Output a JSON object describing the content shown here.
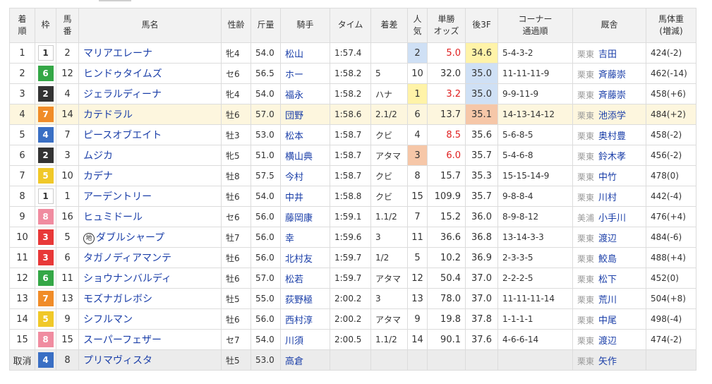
{
  "headers": {
    "rank": "着\n順",
    "waku": "枠",
    "umaban": "馬\n番",
    "name": "馬名",
    "sexage": "性齢",
    "kinryo": "斤量",
    "jockey": "騎手",
    "time": "タイム",
    "margin": "着差",
    "pop": "人\n気",
    "odds": "単勝\nオッズ",
    "last3f": "後3F",
    "corner": "コーナー\n通過順",
    "trainer": "厩舎",
    "weight": "馬体重\n(増減)"
  },
  "rows": [
    {
      "rank": "1",
      "waku": "1",
      "umaban": "2",
      "name": "マリアエレーナ",
      "sexage": "牝4",
      "kinryo": "54.0",
      "jockey": "松山",
      "time": "1:57.4",
      "margin": "",
      "pop": "2",
      "odds": "5.0",
      "oddsRed": true,
      "last3f": "34.6",
      "l3rank": 1,
      "corner": "5-4-3-2",
      "area": "栗東",
      "trainer": "吉田",
      "weight": "424(-2)"
    },
    {
      "rank": "2",
      "waku": "6",
      "umaban": "12",
      "name": "ヒンドゥタイムズ",
      "sexage": "セ6",
      "kinryo": "56.5",
      "jockey": "ホー",
      "time": "1:58.2",
      "margin": "5",
      "pop": "10",
      "odds": "32.0",
      "oddsRed": false,
      "last3f": "35.0",
      "l3rank": 2,
      "corner": "11-11-11-9",
      "area": "栗東",
      "trainer": "斉藤崇",
      "weight": "462(-14)"
    },
    {
      "rank": "3",
      "waku": "2",
      "umaban": "4",
      "name": "ジェラルディーナ",
      "sexage": "牝4",
      "kinryo": "54.0",
      "jockey": "福永",
      "time": "1:58.2",
      "margin": "ハナ",
      "pop": "1",
      "odds": "3.2",
      "oddsRed": true,
      "last3f": "35.0",
      "l3rank": 2,
      "corner": "9-9-11-9",
      "area": "栗東",
      "trainer": "斉藤崇",
      "weight": "458(+6)"
    },
    {
      "rank": "4",
      "waku": "7",
      "umaban": "14",
      "name": "カテドラル",
      "sexage": "牡6",
      "kinryo": "57.0",
      "jockey": "団野",
      "time": "1:58.6",
      "margin": "2.1/2",
      "pop": "6",
      "odds": "13.7",
      "oddsRed": false,
      "last3f": "35.1",
      "l3rank": 3,
      "corner": "14-13-14-12",
      "area": "栗東",
      "trainer": "池添学",
      "weight": "484(+2)",
      "highlight": true
    },
    {
      "rank": "5",
      "waku": "4",
      "umaban": "7",
      "name": "ピースオブエイト",
      "sexage": "牡3",
      "kinryo": "53.0",
      "jockey": "松本",
      "time": "1:58.7",
      "margin": "クビ",
      "pop": "4",
      "odds": "8.5",
      "oddsRed": true,
      "last3f": "35.6",
      "l3rank": 0,
      "corner": "5-6-8-5",
      "area": "栗東",
      "trainer": "奥村豊",
      "weight": "458(-2)"
    },
    {
      "rank": "6",
      "waku": "2",
      "umaban": "3",
      "name": "ムジカ",
      "sexage": "牝5",
      "kinryo": "51.0",
      "jockey": "横山典",
      "time": "1:58.7",
      "margin": "アタマ",
      "pop": "3",
      "odds": "6.0",
      "oddsRed": true,
      "last3f": "35.7",
      "l3rank": 0,
      "corner": "5-4-6-8",
      "area": "栗東",
      "trainer": "鈴木孝",
      "weight": "456(-2)"
    },
    {
      "rank": "7",
      "waku": "5",
      "umaban": "10",
      "name": "カデナ",
      "sexage": "牡8",
      "kinryo": "57.5",
      "jockey": "今村",
      "time": "1:58.7",
      "margin": "クビ",
      "pop": "8",
      "odds": "15.7",
      "oddsRed": false,
      "last3f": "35.3",
      "l3rank": 0,
      "corner": "15-15-14-9",
      "area": "栗東",
      "trainer": "中竹",
      "weight": "478(0)"
    },
    {
      "rank": "8",
      "waku": "1",
      "umaban": "1",
      "name": "アーデントリー",
      "sexage": "牡6",
      "kinryo": "54.0",
      "jockey": "中井",
      "time": "1:58.8",
      "margin": "クビ",
      "pop": "15",
      "odds": "109.9",
      "oddsRed": false,
      "last3f": "35.7",
      "l3rank": 0,
      "corner": "9-8-8-4",
      "area": "栗東",
      "trainer": "川村",
      "weight": "442(-4)"
    },
    {
      "rank": "9",
      "waku": "8",
      "umaban": "16",
      "name": "ヒュミドール",
      "sexage": "セ6",
      "kinryo": "56.0",
      "jockey": "藤岡康",
      "time": "1:59.1",
      "margin": "1.1/2",
      "pop": "7",
      "odds": "15.2",
      "oddsRed": false,
      "last3f": "36.0",
      "l3rank": 0,
      "corner": "8-9-8-12",
      "area": "美浦",
      "trainer": "小手川",
      "weight": "476(+4)"
    },
    {
      "rank": "10",
      "waku": "3",
      "umaban": "5",
      "name": "ダブルシャープ",
      "chihou": "地",
      "sexage": "牡7",
      "kinryo": "56.0",
      "jockey": "幸",
      "time": "1:59.6",
      "margin": "3",
      "pop": "11",
      "odds": "36.6",
      "oddsRed": false,
      "last3f": "36.8",
      "l3rank": 0,
      "corner": "13-14-3-3",
      "area": "栗東",
      "trainer": "渡辺",
      "weight": "484(-6)"
    },
    {
      "rank": "11",
      "waku": "3",
      "umaban": "6",
      "name": "タガノディアマンテ",
      "sexage": "牡6",
      "kinryo": "56.0",
      "jockey": "北村友",
      "time": "1:59.7",
      "margin": "1/2",
      "pop": "5",
      "odds": "10.2",
      "oddsRed": false,
      "last3f": "36.9",
      "l3rank": 0,
      "corner": "2-3-3-5",
      "area": "栗東",
      "trainer": "鮫島",
      "weight": "488(+4)"
    },
    {
      "rank": "12",
      "waku": "6",
      "umaban": "11",
      "name": "ショウナンバルディ",
      "sexage": "牡6",
      "kinryo": "57.0",
      "jockey": "松若",
      "time": "1:59.7",
      "margin": "アタマ",
      "pop": "12",
      "odds": "50.4",
      "oddsRed": false,
      "last3f": "37.0",
      "l3rank": 0,
      "corner": "2-2-2-5",
      "area": "栗東",
      "trainer": "松下",
      "weight": "452(0)"
    },
    {
      "rank": "13",
      "waku": "7",
      "umaban": "13",
      "name": "モズナガレボシ",
      "sexage": "牡5",
      "kinryo": "55.0",
      "jockey": "荻野極",
      "time": "2:00.2",
      "margin": "3",
      "pop": "13",
      "odds": "78.0",
      "oddsRed": false,
      "last3f": "37.0",
      "l3rank": 0,
      "corner": "11-11-11-14",
      "area": "栗東",
      "trainer": "荒川",
      "weight": "504(+8)"
    },
    {
      "rank": "14",
      "waku": "5",
      "umaban": "9",
      "name": "シフルマン",
      "sexage": "牡6",
      "kinryo": "56.0",
      "jockey": "西村淳",
      "time": "2:00.2",
      "margin": "アタマ",
      "pop": "9",
      "odds": "19.8",
      "oddsRed": false,
      "last3f": "37.8",
      "l3rank": 0,
      "corner": "1-1-1-1",
      "area": "栗東",
      "trainer": "中尾",
      "weight": "498(-4)"
    },
    {
      "rank": "15",
      "waku": "8",
      "umaban": "15",
      "name": "スーパーフェザー",
      "sexage": "セ7",
      "kinryo": "54.0",
      "jockey": "川須",
      "time": "2:00.5",
      "margin": "1.1/2",
      "pop": "14",
      "odds": "90.1",
      "oddsRed": false,
      "last3f": "37.6",
      "l3rank": 0,
      "corner": "4-6-6-14",
      "area": "栗東",
      "trainer": "渡辺",
      "weight": "474(-2)"
    },
    {
      "rank": "取消",
      "waku": "4",
      "umaban": "8",
      "name": "プリマヴィスタ",
      "sexage": "牡5",
      "kinryo": "53.0",
      "jockey": "高倉",
      "time": "",
      "margin": "",
      "pop": "",
      "odds": "",
      "oddsRed": false,
      "last3f": "",
      "l3rank": 0,
      "corner": "",
      "area": "栗東",
      "trainer": "矢作",
      "weight": "",
      "scratched": true
    }
  ],
  "colors": {
    "waku1": "#ffffff",
    "waku2": "#333333",
    "waku3": "#e83838",
    "waku4": "#3a6fc4",
    "waku5": "#f0c828",
    "waku6": "#34a746",
    "waku7": "#f08c28",
    "waku8": "#f08ca0",
    "link": "#1a3ea8",
    "oddsRed": "#e02020",
    "highlightRow": "#fdf6de"
  }
}
